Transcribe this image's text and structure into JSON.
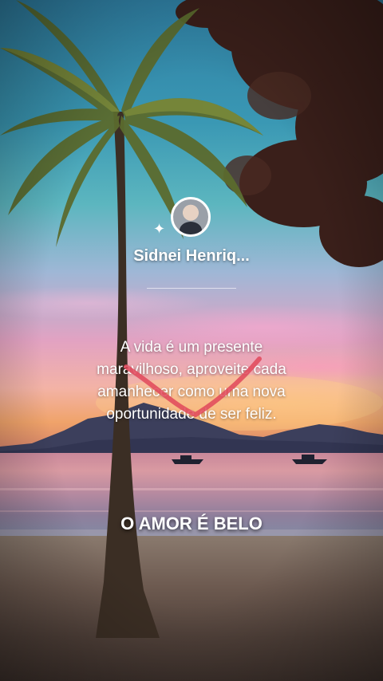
{
  "profile": {
    "name": "Sidnei Henriq...",
    "avatar": "avatar"
  },
  "quote": {
    "text": "A vida é um presente maravilhoso, aproveite cada amanhecer como uma nova oportunidade de ser feliz."
  },
  "footer": {
    "text": "O AMOR É BELO"
  },
  "icons": {
    "sparkle": "sparkle-icon",
    "heart": "heart-doodle-icon"
  },
  "colors": {
    "text": "#ffffff",
    "heart_stroke": "#e0485a"
  }
}
